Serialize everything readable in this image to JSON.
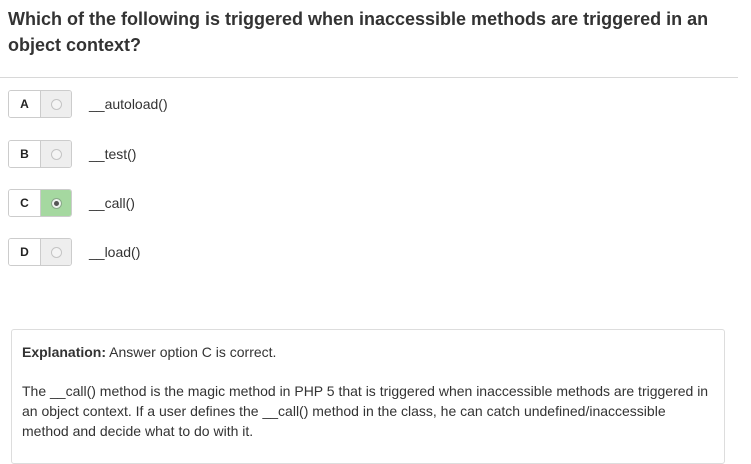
{
  "question": {
    "text": "Which of the following is triggered when inaccessible methods are triggered in an object context?"
  },
  "options": [
    {
      "letter": "A",
      "text": "__autoload()",
      "selected": false
    },
    {
      "letter": "B",
      "text": "__test()",
      "selected": false
    },
    {
      "letter": "C",
      "text": "__call()",
      "selected": true
    },
    {
      "letter": "D",
      "text": "__load()",
      "selected": false
    }
  ],
  "explanation": {
    "label": "Explanation:",
    "summary": "Answer option C is correct.",
    "body": "The __call() method is the magic method in PHP 5 that is triggered when inaccessible methods are triggered in an object context. If a user defines the __call() method in the class, he can catch undefined/inaccessible method and decide what to do with it."
  },
  "colors": {
    "correct_fill": "#a5d8a0",
    "radio_fill": "#eeeeee",
    "border": "#cccccc"
  }
}
